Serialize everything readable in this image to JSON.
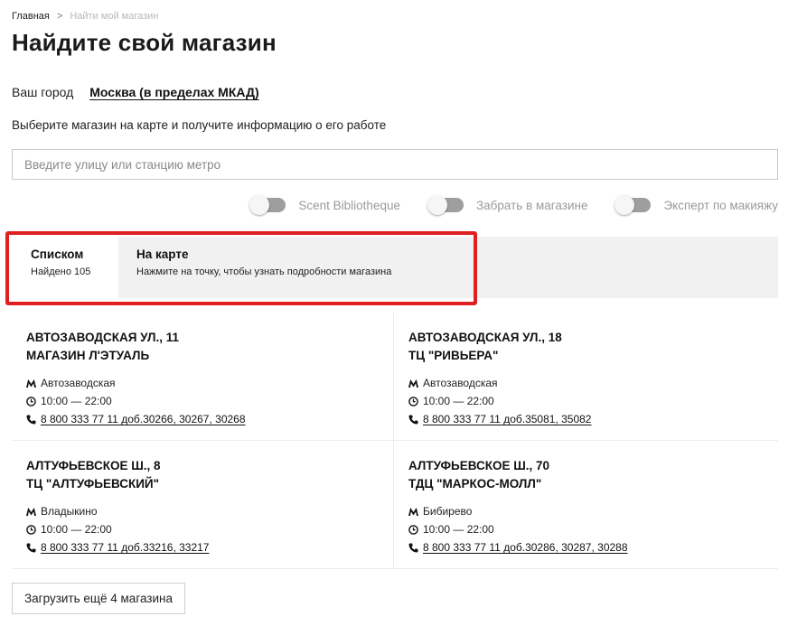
{
  "breadcrumb": {
    "home": "Главная",
    "separator": ">",
    "current": "Найти мой магазин"
  },
  "page_title": "Найдите свой магазин",
  "city": {
    "label": "Ваш город",
    "value": "Москва (в пределах МКАД)"
  },
  "hint": "Выберите магазин на карте и получите информацию о его работе",
  "search": {
    "placeholder": "Введите улицу или станцию метро",
    "value": ""
  },
  "filters": [
    {
      "label": "Scent Bibliotheque",
      "enabled": false
    },
    {
      "label": "Забрать в магазине",
      "enabled": false
    },
    {
      "label": "Эксперт по макияжу",
      "enabled": false
    }
  ],
  "view_tabs": {
    "list": {
      "title": "Списком",
      "subtitle": "Найдено 105"
    },
    "map": {
      "title": "На карте",
      "subtitle": "Нажмите на точку, чтобы узнать подробности магазина"
    }
  },
  "highlight_color": "#e02020",
  "stores": [
    {
      "address": "АВТОЗАВОДСКАЯ УЛ., 11",
      "name": "МАГАЗИН Л'ЭТУАЛЬ",
      "metro": "Автозаводская",
      "hours": "10:00 — 22:00",
      "phone": "8 800 333 77 11 доб.30266, 30267, 30268"
    },
    {
      "address": "АВТОЗАВОДСКАЯ УЛ., 18",
      "name": "ТЦ \"РИВЬЕРА\"",
      "metro": "Автозаводская",
      "hours": "10:00 — 22:00",
      "phone": "8 800 333 77 11 доб.35081, 35082"
    },
    {
      "address": "АЛТУФЬЕВСКОЕ Ш., 8",
      "name": "ТЦ \"АЛТУФЬЕВСКИЙ\"",
      "metro": "Владыкино",
      "hours": "10:00 — 22:00",
      "phone": "8 800 333 77 11 доб.33216, 33217"
    },
    {
      "address": "АЛТУФЬЕВСКОЕ Ш., 70",
      "name": "ТДЦ \"МАРКОС-МОЛЛ\"",
      "metro": "Бибирево",
      "hours": "10:00 — 22:00",
      "phone": "8 800 333 77 11 доб.30286, 30287, 30288"
    }
  ],
  "load_more_label": "Загрузить ещё 4 магазина"
}
